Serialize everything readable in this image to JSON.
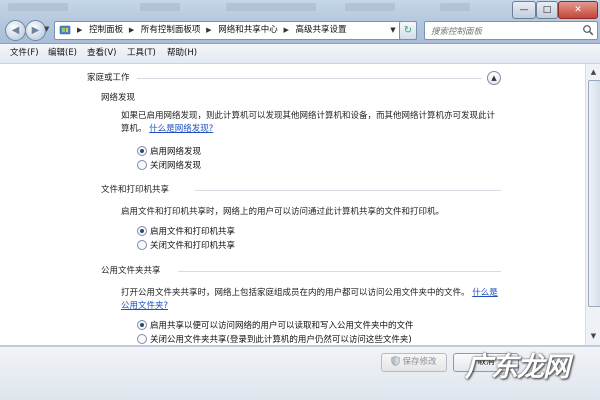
{
  "window": {
    "minimize_label": "—",
    "maximize_label": "□",
    "close_label": "✕"
  },
  "address": {
    "crumbs": [
      "控制面板",
      "所有控制面板项",
      "网络和共享中心",
      "高级共享设置"
    ],
    "search_placeholder": "搜索控制面板"
  },
  "menu": [
    "文件(F)",
    "编辑(E)",
    "查看(V)",
    "工具(T)",
    "帮助(H)"
  ],
  "profile": {
    "title": "家庭或工作",
    "sections": [
      {
        "title": "网络发现",
        "description": "如果已启用网络发现，则此计算机可以发现其他网络计算机和设备，而其他网络计算机亦可发现此计算机。",
        "link": "什么是网络发现?",
        "options": [
          {
            "label": "启用网络发现",
            "selected": true
          },
          {
            "label": "关闭网络发现",
            "selected": false
          }
        ]
      },
      {
        "title": "文件和打印机共享",
        "description": "启用文件和打印机共享时，网络上的用户可以访问通过此计算机共享的文件和打印机。",
        "link": "",
        "options": [
          {
            "label": "启用文件和打印机共享",
            "selected": true
          },
          {
            "label": "关闭文件和打印机共享",
            "selected": false
          }
        ]
      },
      {
        "title": "公用文件夹共享",
        "description": "打开公用文件夹共享时，网络上包括家庭组成员在内的用户都可以访问公用文件夹中的文件。",
        "link": "什么是公用文件夹?",
        "options": [
          {
            "label": "启用共享以便可以访问网络的用户可以读取和写入公用文件夹中的文件",
            "selected": true
          },
          {
            "label": "关闭公用文件夹共享(登录到此计算机的用户仍然可以访问这些文件夹)",
            "selected": false
          }
        ]
      }
    ]
  },
  "footer": {
    "save_label": "保存修改",
    "cancel_label": "取消",
    "save_enabled": false
  },
  "watermark": "广东龙网",
  "colors": {
    "link": "#1f4fbf",
    "titlebar": "#b3c7dd",
    "content_bg": "#ffffff"
  }
}
